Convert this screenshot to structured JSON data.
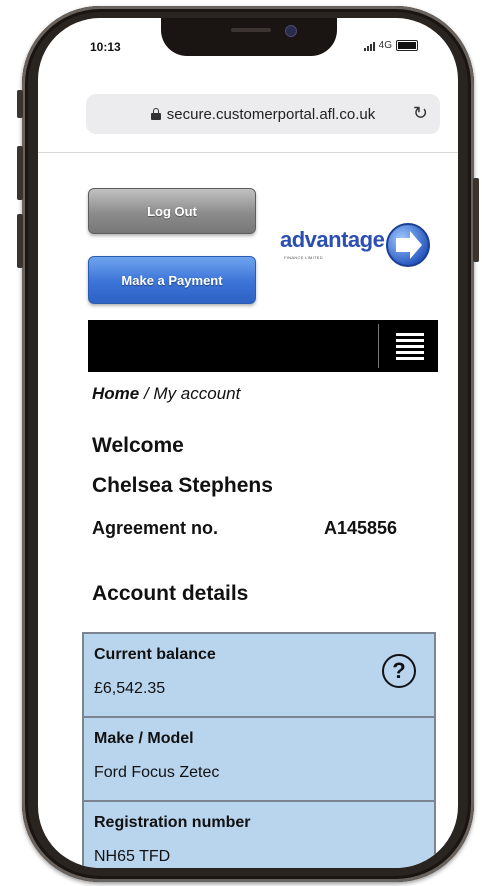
{
  "status_bar": {
    "time": "10:13",
    "network": "4G"
  },
  "browser": {
    "url": "secure.customerportal.afl.co.uk"
  },
  "header": {
    "logout_label": "Log Out",
    "payment_label": "Make a Payment",
    "logo_text": "advantage",
    "logo_subtext": "FINANCE LIMITED",
    "brand_color": "#2b4eb0"
  },
  "breadcrumb": {
    "home": "Home",
    "separator": " / ",
    "current": "My account"
  },
  "welcome": {
    "greeting": "Welcome",
    "name": "Chelsea Stephens"
  },
  "agreement": {
    "label": "Agreement no.",
    "value": "A145856"
  },
  "account_details": {
    "title": "Account details",
    "rows": [
      {
        "label": "Current balance",
        "value": "£6,542.35"
      },
      {
        "label": "Make / Model",
        "value": "Ford Focus Zetec"
      },
      {
        "label": "Registration number",
        "value": "NH65 TFD"
      }
    ]
  },
  "icons": {
    "help": "help-circle-icon",
    "menu": "hamburger-menu-icon",
    "lock": "lock-icon",
    "reload": "reload-icon"
  },
  "colors": {
    "table_bg": "#b9d5ee",
    "nav_bg": "#000000",
    "payment_button": "#3b73d6",
    "logout_button": "#8c8c8c"
  }
}
